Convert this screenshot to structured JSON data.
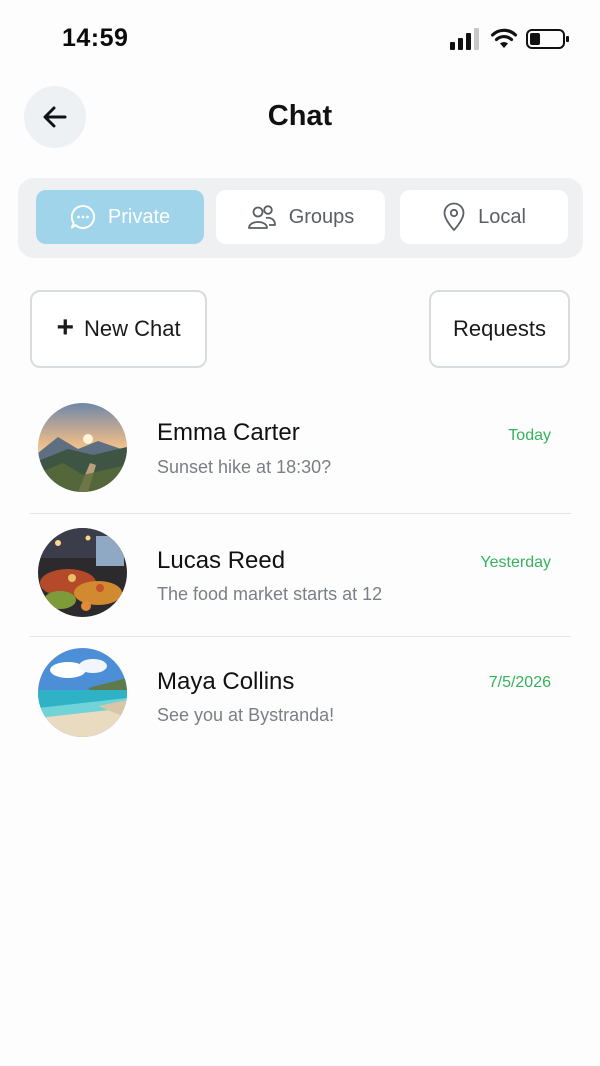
{
  "status_bar": {
    "time": "14:59"
  },
  "header": {
    "title": "Chat",
    "back_icon": "arrow-left-icon"
  },
  "tabs": [
    {
      "label": "Private",
      "icon": "chat-bubble-icon",
      "active": true
    },
    {
      "label": "Groups",
      "icon": "users-icon",
      "active": false
    },
    {
      "label": "Local",
      "icon": "location-pin-icon",
      "active": false
    }
  ],
  "actions": {
    "new_chat_label": "New Chat",
    "new_chat_icon": "+",
    "requests_label": "Requests"
  },
  "chats": [
    {
      "name": "Emma Carter",
      "preview": "Sunset hike at 18:30?",
      "date": "Today",
      "avatar": "sunset-mountain-photo"
    },
    {
      "name": "Lucas Reed",
      "preview": "The food market starts at 12",
      "date": "Yesterday",
      "avatar": "food-market-photo"
    },
    {
      "name": "Maya Collins",
      "preview": "See you at Bystranda!",
      "date": "7/5/2026",
      "avatar": "beach-photo"
    }
  ],
  "colors": {
    "active_tab": "#9fd4ea",
    "date_green": "#35b35c",
    "preview_gray": "#7a7f86",
    "back_button_bg": "#eef1f3",
    "tabs_track_bg": "#eef0f2"
  }
}
